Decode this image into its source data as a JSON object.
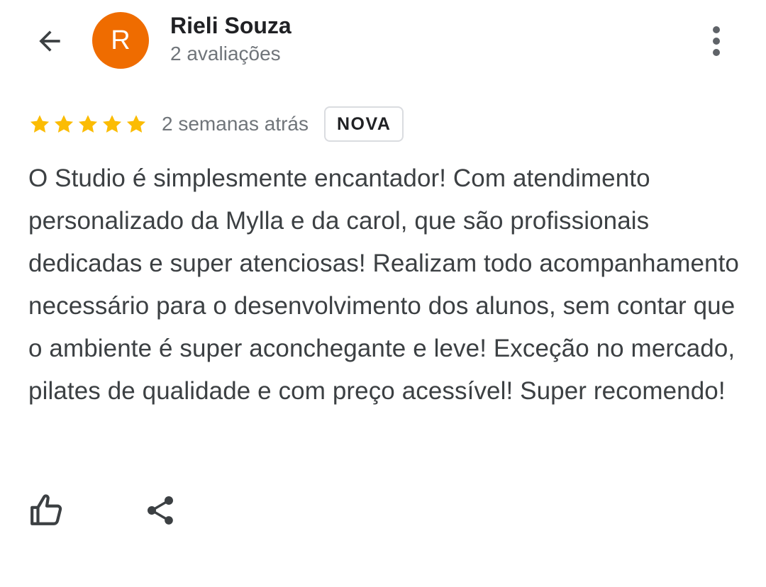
{
  "header": {
    "back_icon": "arrow-back-icon",
    "avatar_letter": "R",
    "avatar_color": "#ef6c00",
    "reviewer_name": "Rieli Souza",
    "reviewer_review_count": "2 avaliações",
    "more_icon": "more-vert-icon"
  },
  "review": {
    "rating": 5,
    "rating_max": 5,
    "star_color": "#fbbc04",
    "date": "2 semanas atrás",
    "badge": "NOVA",
    "text": "O Studio é simplesmente encantador! Com atendimento personalizado da Mylla e da carol, que são profissionais dedicadas e super atenciosas! Realizam todo acompanhamento necessário para o desenvolvimento dos alunos, sem contar que o ambiente é super aconchegante e leve! Exceção no mercado, pilates de qualidade e com preço acessível! Super recomendo!"
  },
  "actions": {
    "like_icon": "thumb-up-icon",
    "share_icon": "share-icon"
  }
}
